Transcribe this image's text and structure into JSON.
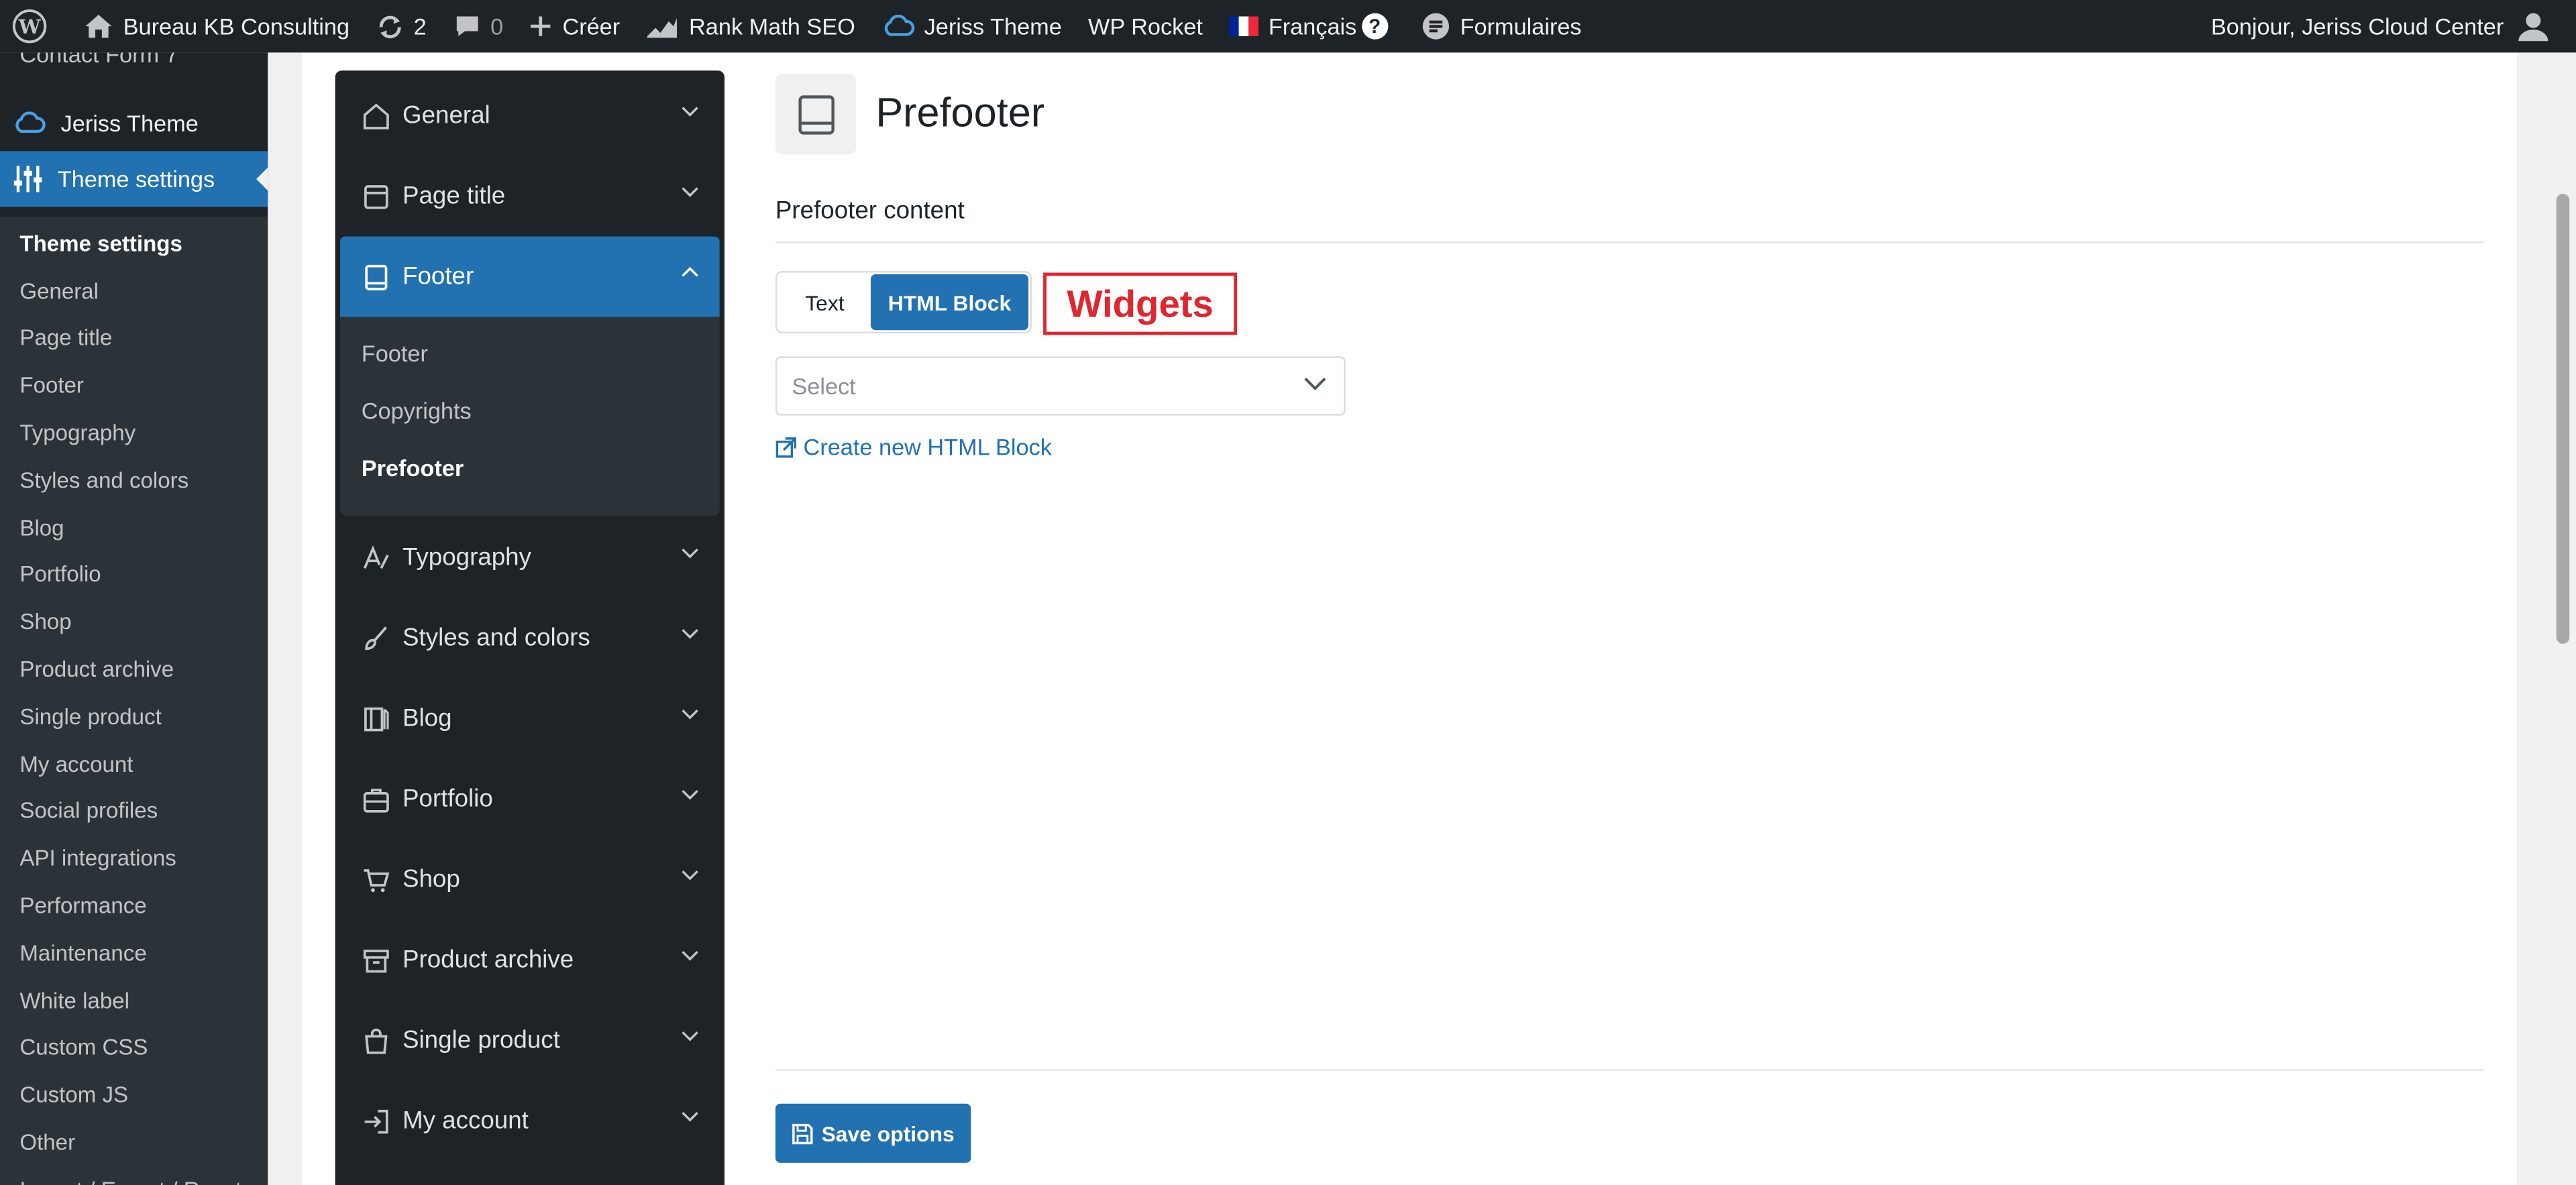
{
  "adminbar": {
    "site_name": "Bureau KB Consulting",
    "updates_count": "2",
    "comments_count": "0",
    "new_label": "Créer",
    "rankmath_label": "Rank Math SEO",
    "theme_label": "Jeriss Theme",
    "wprocket_label": "WP Rocket",
    "language_label": "Français",
    "help_label": "?",
    "forms_label": "Formulaires",
    "greeting": "Bonjour, Jeriss Cloud Center"
  },
  "wpmenu": {
    "cutoff_item": "Contact Form 7",
    "theme_item": "Jeriss Theme",
    "active_item": "Theme settings",
    "submenu": [
      "Theme settings",
      "General",
      "Page title",
      "Footer",
      "Typography",
      "Styles and colors",
      "Blog",
      "Portfolio",
      "Shop",
      "Product archive",
      "Single product",
      "My account",
      "Social profiles",
      "API integrations",
      "Performance",
      "Maintenance",
      "White label",
      "Custom CSS",
      "Custom JS",
      "Other",
      "Import / Export / Reset"
    ]
  },
  "settings_nav": {
    "items": [
      {
        "label": "General",
        "icon": "home-icon"
      },
      {
        "label": "Page title",
        "icon": "page-title-icon"
      },
      {
        "label": "Footer",
        "icon": "footer-icon"
      },
      {
        "label": "Typography",
        "icon": "typography-icon"
      },
      {
        "label": "Styles and colors",
        "icon": "brush-icon"
      },
      {
        "label": "Blog",
        "icon": "blog-icon"
      },
      {
        "label": "Portfolio",
        "icon": "briefcase-icon"
      },
      {
        "label": "Shop",
        "icon": "cart-icon"
      },
      {
        "label": "Product archive",
        "icon": "archive-icon"
      },
      {
        "label": "Single product",
        "icon": "bag-icon"
      },
      {
        "label": "My account",
        "icon": "login-icon"
      }
    ],
    "footer_sub": [
      "Footer",
      "Copyrights",
      "Prefooter"
    ]
  },
  "pane": {
    "title": "Prefooter",
    "section_label": "Prefooter content",
    "toggle_text": "Text",
    "toggle_html": "HTML Block",
    "annotation": "Widgets",
    "select_placeholder": "Select",
    "create_link": "Create new HTML Block",
    "save_label": "Save options"
  },
  "colors": {
    "accent": "#2271b1",
    "dark": "#1d2327",
    "annotation_red": "#e0262f"
  }
}
